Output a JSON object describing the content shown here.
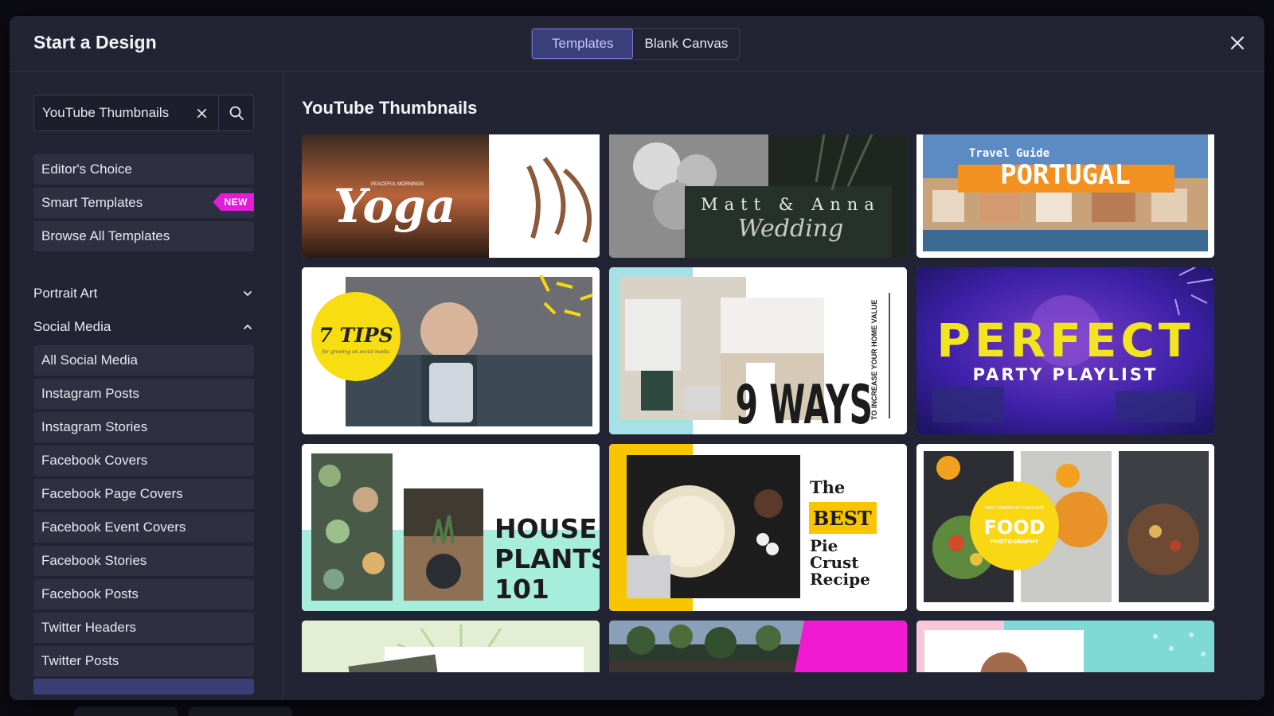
{
  "header": {
    "title": "Start a Design",
    "tabs": [
      {
        "label": "Templates",
        "active": true
      },
      {
        "label": "Blank Canvas",
        "active": false
      }
    ],
    "close_icon": "close-icon"
  },
  "sidebar": {
    "search": {
      "value": "YouTube Thumbnails",
      "placeholder": ""
    },
    "top_items": [
      {
        "label": "Editor's Choice"
      },
      {
        "label": "Smart Templates",
        "badge": "NEW"
      },
      {
        "label": "Browse All Templates"
      }
    ],
    "sections": [
      {
        "label": "Portrait Art",
        "expanded": false
      },
      {
        "label": "Social Media",
        "expanded": true
      }
    ],
    "social_items": [
      "All Social Media",
      "Instagram Posts",
      "Instagram Stories",
      "Facebook Covers",
      "Facebook Page Covers",
      "Facebook Event Covers",
      "Facebook Stories",
      "Facebook Posts",
      "Twitter Headers",
      "Twitter Posts"
    ]
  },
  "main": {
    "title": "YouTube Thumbnails",
    "cards": [
      {
        "name": "yoga",
        "title": "Yoga",
        "subtitle": "PEACEFUL MORNINGS"
      },
      {
        "name": "wedding",
        "title": "Matt & Anna",
        "subtitle": "Wedding"
      },
      {
        "name": "portugal",
        "title": "PORTUGAL",
        "subtitle": "Travel Guide"
      },
      {
        "name": "tips",
        "title": "7 TIPS",
        "subtitle": "for growing on social media"
      },
      {
        "name": "ways",
        "title": "9 WAYS",
        "subtitle": "TO INCREASE YOUR HOME VALUE"
      },
      {
        "name": "party",
        "title": "PERFECT",
        "subtitle": "PARTY PLAYLIST"
      },
      {
        "name": "plants",
        "title": "HOUSE PLANTS 101"
      },
      {
        "name": "pie",
        "title": "The BEST Pie Crust Recipe",
        "highlight": "BEST"
      },
      {
        "name": "food",
        "title": "FOOD",
        "subtitle": "PHOTOGRAPHY",
        "small": "BEST CAMERA SETTINGS FOR"
      }
    ]
  },
  "colors": {
    "accent": "#6f75d8",
    "badge": "#e21dd6",
    "modal": "#232433"
  }
}
